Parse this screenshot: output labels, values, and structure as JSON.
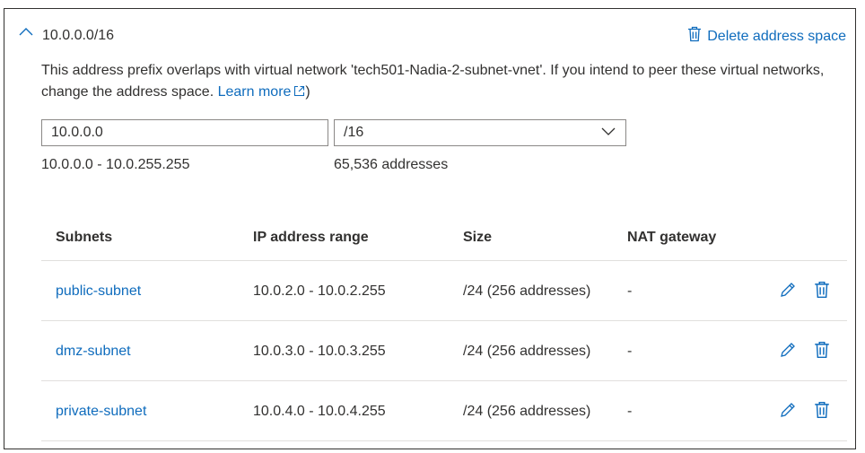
{
  "address_space": {
    "title": "10.0.0.0/16",
    "delete_label": "Delete address space",
    "warning": "This address prefix overlaps with virtual network 'tech501-Nadia-2-subnet-vnet'. If you intend to peer these virtual networks, change the address space.",
    "learn_more": "Learn more",
    "closing_paren": ")",
    "ip_value": "10.0.0.0",
    "mask_value": "/16",
    "range": "10.0.0.0 - 10.0.255.255",
    "count": "65,536 addresses"
  },
  "table": {
    "headers": [
      "Subnets",
      "IP address range",
      "Size",
      "NAT gateway"
    ],
    "rows": [
      {
        "name": "public-subnet",
        "range": "10.0.2.0 - 10.0.2.255",
        "size": "/24 (256 addresses)",
        "nat": "-"
      },
      {
        "name": "dmz-subnet",
        "range": "10.0.3.0 - 10.0.3.255",
        "size": "/24 (256 addresses)",
        "nat": "-"
      },
      {
        "name": "private-subnet",
        "range": "10.0.4.0 - 10.0.4.255",
        "size": "/24 (256 addresses)",
        "nat": "-"
      }
    ]
  },
  "icons": {
    "collapse": "chevron-up-icon",
    "delete": "trash-icon",
    "external": "external-link-icon",
    "dropdown": "chevron-down-icon",
    "edit": "pencil-icon"
  },
  "colors": {
    "link": "#0f6cbd",
    "text": "#323130",
    "border": "#8a8886",
    "divider": "#e1dfdd"
  }
}
